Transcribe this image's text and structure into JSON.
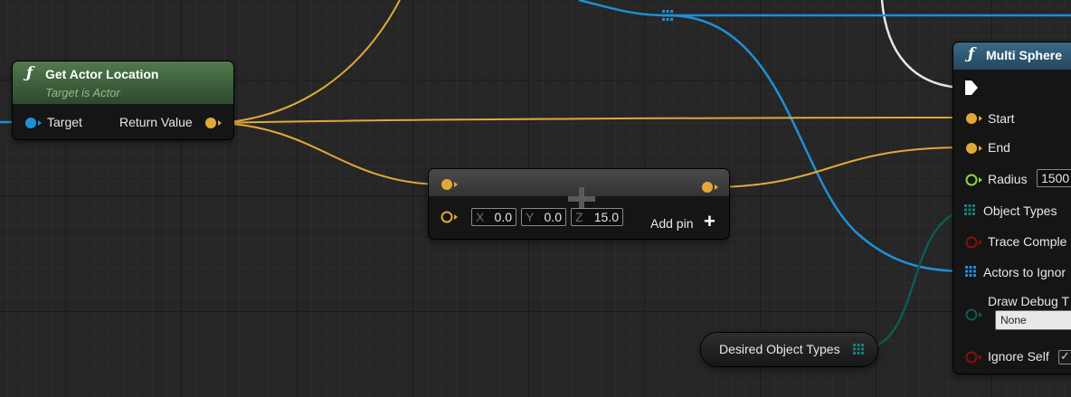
{
  "colors": {
    "vector_wire": "#e0a93a",
    "object_wire": "#1e90d6",
    "exec_wire": "#e6e6e6",
    "object_type_wire": "#0e5a54",
    "func_header": "#3c5e3a"
  },
  "get_actor_location": {
    "icon": "ƒ",
    "title": "Get Actor Location",
    "subtitle": "Target is Actor",
    "target_label": "Target",
    "return_label": "Return Value"
  },
  "add_node": {
    "x_axis": "X",
    "x_value": "0.0",
    "y_axis": "Y",
    "y_value": "0.0",
    "z_axis": "Z",
    "z_value": "15.0",
    "add_pin_label": "Add pin",
    "add_pin_icon": "+"
  },
  "multi_sphere": {
    "icon": "ƒ",
    "title": "Multi Sphere",
    "start_label": "Start",
    "end_label": "End",
    "radius_label": "Radius",
    "radius_value": "1500",
    "object_types_label": "Object Types",
    "trace_complex_label": "Trace Comple",
    "actors_ignore_label": "Actors to Ignor",
    "draw_debug_label": "Draw Debug T",
    "draw_debug_value": "None",
    "ignore_self_label": "Ignore Self",
    "ignore_self_checked": "✓"
  },
  "desired_object_types": {
    "label": "Desired Object Types"
  }
}
